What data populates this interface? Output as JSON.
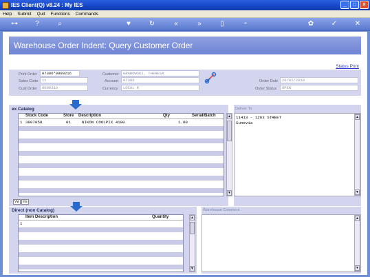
{
  "window": {
    "title": "IES Client(Q) v8.24 : My IES"
  },
  "menu": {
    "help": "Help",
    "submit": "Submit",
    "quit": "Quit",
    "functions": "Functions",
    "commands": "Commands"
  },
  "page": {
    "title": "Warehouse Order Indent: Query Customer Order",
    "status_print": "Status Print"
  },
  "fields": {
    "print_order_label": "Print Order",
    "print_order_value": "07306*0000216",
    "sales_code_label": "Sales Code",
    "sales_code_value": "tt",
    "cust_order_label": "Cust Order",
    "cust_order_value": "0000316",
    "customer_label": "Customer",
    "customer_value": "GRABOWSKI, THERESA",
    "account_label": "Account",
    "account_value": "07306",
    "currency_label": "Currency",
    "currency_value": "LOCAL R",
    "order_date_label": "Order Date",
    "order_date_value": "26/01/2010",
    "order_status_label": "Order Status",
    "order_status_value": "OPEN"
  },
  "ex_catalog": {
    "title": "ex Catalog",
    "columns": {
      "stock_code": "Stock Code",
      "store": "Store",
      "description": "Description",
      "qty": "Qty",
      "serial": "Serial/Batch"
    },
    "rows": [
      {
        "n": "1",
        "stock_code": "3007058",
        "store": "01",
        "description": "NIKON COOLPIX 4100",
        "qty": "1.00",
        "serial": ""
      }
    ],
    "tabs": [
      "Vw",
      "Ins"
    ]
  },
  "deliver_to": {
    "label": "Deliver To",
    "line1": "11413 - 1263 STREET",
    "line2": "Sunevia"
  },
  "direct": {
    "title": "Direct (non Catalog)",
    "columns": {
      "item_description": "Item Description",
      "quantity": "Quantity"
    },
    "rows": [
      {
        "n": "1",
        "item_description": "",
        "quantity": ""
      }
    ]
  },
  "warehouse_comment": {
    "label": "Warehouse Comment"
  },
  "colors": {
    "title_blue": "#1646c8",
    "header_band": "#7f93d9",
    "panel": "#d3d5ee",
    "row_alt": "#c9cbe6",
    "accent_arrow": "#2a6acc"
  },
  "icons": [
    "app-icon",
    "key-icon",
    "help-icon",
    "search-icon",
    "heart-icon",
    "refresh-icon",
    "rewind-icon",
    "fast-forward-icon",
    "document-icon",
    "copy-icon",
    "settings-icon",
    "check-icon",
    "close-icon",
    "link-tool-icon"
  ]
}
